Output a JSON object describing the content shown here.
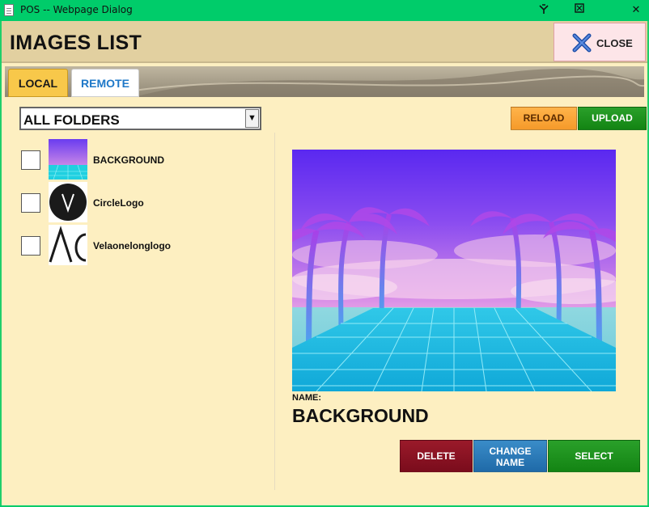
{
  "titlebar": {
    "title": "POS -- Webpage Dialog",
    "icons": [
      "document-icon",
      "pin-icon",
      "restore-icon",
      "close-icon"
    ],
    "close_glyph": "✕"
  },
  "header": {
    "title": "IMAGES LIST",
    "close_label": "CLOSE"
  },
  "tabs": [
    {
      "label": "LOCAL",
      "active": true
    },
    {
      "label": "REMOTE",
      "active": false
    }
  ],
  "folder_select": {
    "value": "ALL FOLDERS",
    "arrow": "▼"
  },
  "toolbar": {
    "reload_label": "RELOAD",
    "upload_label": "UPLOAD"
  },
  "images": [
    {
      "name": "BACKGROUND",
      "checked": false
    },
    {
      "name": "CircleLogo",
      "checked": false
    },
    {
      "name": "Velaonelonglogo",
      "checked": false
    }
  ],
  "details": {
    "name_label": "NAME:",
    "name_value": "BACKGROUND"
  },
  "actions": {
    "delete_label": "DELETE",
    "change_name_line1": "CHANGE",
    "change_name_line2": "NAME",
    "select_label": "SELECT"
  },
  "colors": {
    "titlebar": "#00cc6a",
    "panel": "#fdefc1",
    "header": "#e2d0a0",
    "reload": "#f59a2a",
    "upload": "#138413",
    "delete": "#7a0c1c",
    "change_name": "#1f6aa8",
    "select": "#138413"
  }
}
